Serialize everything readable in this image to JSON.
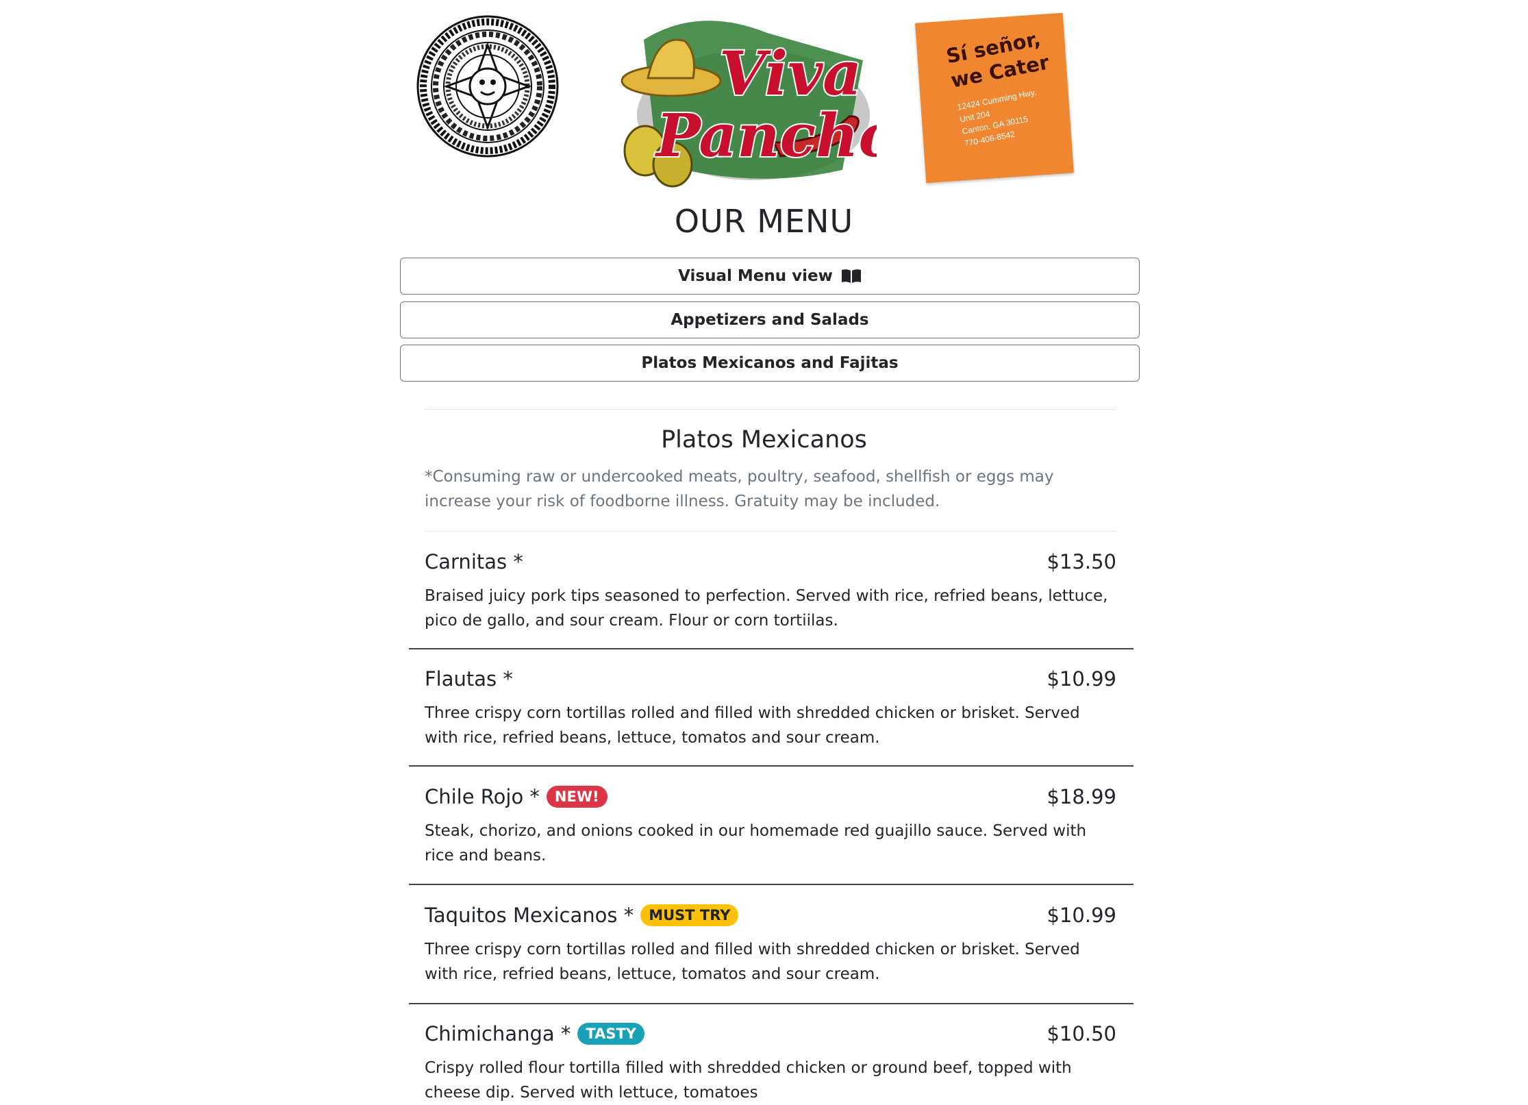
{
  "header": {
    "logo_text_line1": "Viva",
    "logo_text_line2": "Pancho",
    "cater_headline_1": "Sí señor,",
    "cater_headline_2": "we Cater",
    "cater_address_1": "12424 Cumming Hwy.",
    "cater_address_2": "Unit 204",
    "cater_address_3": "Canton, GA 30115",
    "cater_phone": "770-406-8542"
  },
  "menu_title": "OUR MENU",
  "nav": {
    "visual_menu": "Visual Menu view",
    "appetizers": "Appetizers and Salads",
    "platos": "Platos Mexicanos and Fajitas"
  },
  "section": {
    "title": "Platos Mexicanos",
    "disclaimer": "*Consuming raw or undercooked meats, poultry, seafood, shellfish or eggs may increase your risk of foodborne illness. Gratuity may be included."
  },
  "items": [
    {
      "name": "Carnitas *",
      "price": "$13.50",
      "badge": "",
      "desc": "Braised juicy pork tips seasoned to perfection. Served with rice, refried beans, lettuce, pico de gallo, and sour cream. Flour or corn tortiilas."
    },
    {
      "name": "Flautas *",
      "price": "$10.99",
      "badge": "",
      "desc": "Three crispy corn tortillas rolled and filled with shredded chicken or brisket. Served with rice, refried beans, lettuce, tomatos and sour cream."
    },
    {
      "name": "Chile Rojo *",
      "price": "$18.99",
      "badge": "NEW!",
      "desc": "Steak, chorizo, and onions cooked in our homemade red guajillo sauce. Served with rice and beans."
    },
    {
      "name": "Taquitos Mexicanos *",
      "price": "$10.99",
      "badge": "MUST TRY",
      "desc": "Three crispy corn tortillas rolled and filled with shredded chicken or brisket. Served with rice, refried beans, lettuce, tomatos and sour cream."
    },
    {
      "name": "Chimichanga *",
      "price": "$10.50",
      "badge": "TASTY",
      "desc": "Crispy rolled flour tortilla filled with shredded chicken or ground beef, topped with cheese dip. Served with lettuce, tomatoes"
    }
  ],
  "colors": {
    "badge_new": "#dc3545",
    "badge_must_try": "#ffc107",
    "badge_tasty": "#17a2b8",
    "cater_bg": "#f0862f"
  }
}
